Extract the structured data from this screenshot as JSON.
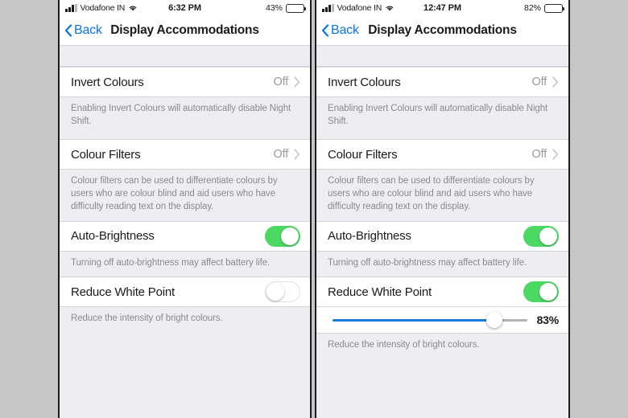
{
  "panels": [
    {
      "status": {
        "carrier": "Vodafone IN",
        "time": "6:32 PM",
        "battery_text": "43%",
        "battery_level": 43,
        "signal_bars": 3,
        "wifi": "wifi-icon"
      },
      "nav": {
        "back_label": "Back",
        "title": "Display Accommodations"
      },
      "rows": [
        {
          "label": "Invert Colours",
          "type": "disclosure",
          "value": "Off",
          "footer": "Enabling Invert Colours will automatically disable Night Shift."
        },
        {
          "label": "Colour Filters",
          "type": "disclosure",
          "value": "Off",
          "footer": "Colour filters can be used to differentiate colours by users who are colour blind and aid users who have difficulty reading text on the display."
        },
        {
          "label": "Auto-Brightness",
          "type": "switch",
          "switch_on": true,
          "footer": "Turning off auto-brightness may affect battery life."
        },
        {
          "label": "Reduce White Point",
          "type": "switch",
          "switch_on": false,
          "slider": null,
          "footer": "Reduce the intensity of bright colours."
        }
      ]
    },
    {
      "status": {
        "carrier": "Vodafone IN",
        "time": "12:47 PM",
        "battery_text": "82%",
        "battery_level": 82,
        "signal_bars": 3,
        "wifi": "wifi-icon"
      },
      "nav": {
        "back_label": "Back",
        "title": "Display Accommodations"
      },
      "rows": [
        {
          "label": "Invert Colours",
          "type": "disclosure",
          "value": "Off",
          "footer": "Enabling Invert Colours will automatically disable Night Shift."
        },
        {
          "label": "Colour Filters",
          "type": "disclosure",
          "value": "Off",
          "footer": "Colour filters can be used to differentiate colours by users who are colour blind and aid users who have difficulty reading text on the display."
        },
        {
          "label": "Auto-Brightness",
          "type": "switch",
          "switch_on": true,
          "footer": "Turning off auto-brightness may affect battery life."
        },
        {
          "label": "Reduce White Point",
          "type": "switch",
          "switch_on": true,
          "slider": {
            "value": 83,
            "value_label": "83%"
          },
          "footer": "Reduce the intensity of bright colours."
        }
      ]
    }
  ],
  "colors": {
    "accent_blue": "#0a74e8",
    "slider_blue": "#1a7ae0",
    "switch_green": "#4bd863",
    "page_background": "#c6c6c6",
    "list_background": "#eeeef2",
    "row_background": "#ffffff",
    "muted_text": "#8a8a90"
  }
}
